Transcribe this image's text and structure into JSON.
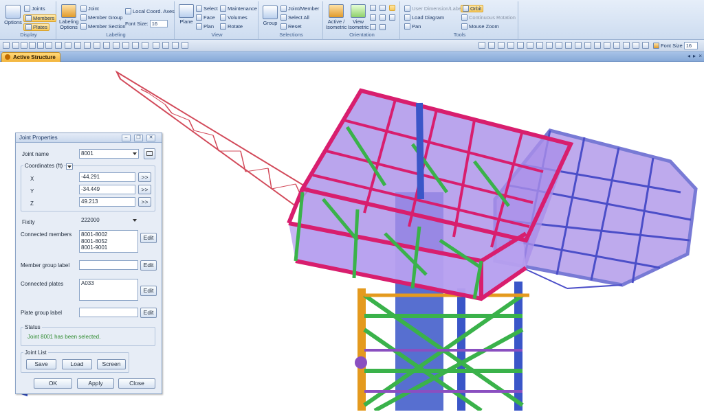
{
  "ribbon": {
    "display": {
      "options": "Options",
      "joints": "Joints",
      "members": "Members",
      "plates": "Plates",
      "caption": "Display"
    },
    "labeling": {
      "labeling_options": "Labeling Options",
      "joint": "Joint",
      "member_group": "Member Group",
      "member_section": "Member Section",
      "local_axes": "Local Coord. Axes",
      "font_size_label": "Font Size:",
      "font_size": "16",
      "caption": "Labeling"
    },
    "view": {
      "plane": "Plane",
      "select": "Select",
      "face": "Face",
      "plan": "Plan",
      "maintenance": "Maintenance",
      "volumes": "Volumes",
      "rotate": "Rotate",
      "caption": "View"
    },
    "selections": {
      "group": "Group",
      "joint_member": "Joint/Member",
      "select_all": "Select All",
      "reset": "Reset",
      "caption": "Selections"
    },
    "orientation": {
      "active_isometric": "Active / Isometric",
      "view_isometric": "View Isometric",
      "caption": "Orientation"
    },
    "tools": {
      "user_dimension": "User Dimension/Label",
      "orbit": "Orbit",
      "load_diagram": "Load Diagram",
      "continuous_rotation": "Continuous Rotation",
      "pan": "Pan",
      "mouse_zoom": "Mouse Zoom",
      "caption": "Tools"
    }
  },
  "toolbar": {
    "font_size_label": "Font Size",
    "font_size": "16"
  },
  "tab": {
    "label": "Active Structure"
  },
  "dialog": {
    "title": "Joint Properties",
    "joint_name_label": "Joint name",
    "joint_name": "8001",
    "coordinates_label": "Coordinates (ft)",
    "x_label": "X",
    "x_value": "-44.291",
    "y_label": "Y",
    "y_value": "-34.449",
    "z_label": "Z",
    "z_value": "49.213",
    "arrow": ">>",
    "fixity_label": "Fixity",
    "fixity": "222000",
    "connected_members_label": "Connected members",
    "connected_members": [
      "8001-8002",
      "8001-8052",
      "8001-9001"
    ],
    "member_group_label": "Member group label",
    "member_group": "",
    "connected_plates_label": "Connected plates",
    "connected_plates": [
      "A033"
    ],
    "plate_group_label": "Plate group label",
    "plate_group": "",
    "edit": "Edit",
    "status_label": "Status",
    "status_text": "Joint 8001 has been selected.",
    "joint_list_label": "Joint List",
    "save": "Save",
    "load": "Load",
    "screen": "Screen",
    "ok": "OK",
    "apply": "Apply",
    "close": "Close"
  },
  "colors": {
    "deck_beams": "#d81e6e",
    "deck_fill": "#a98ee8",
    "cantilever": "#4b4ec8",
    "boom": "#d24a5a",
    "braces": "#3ab24a",
    "legs": "#3a56c8",
    "status_text": "#2e8a2e",
    "tab": "#f3b33a"
  }
}
